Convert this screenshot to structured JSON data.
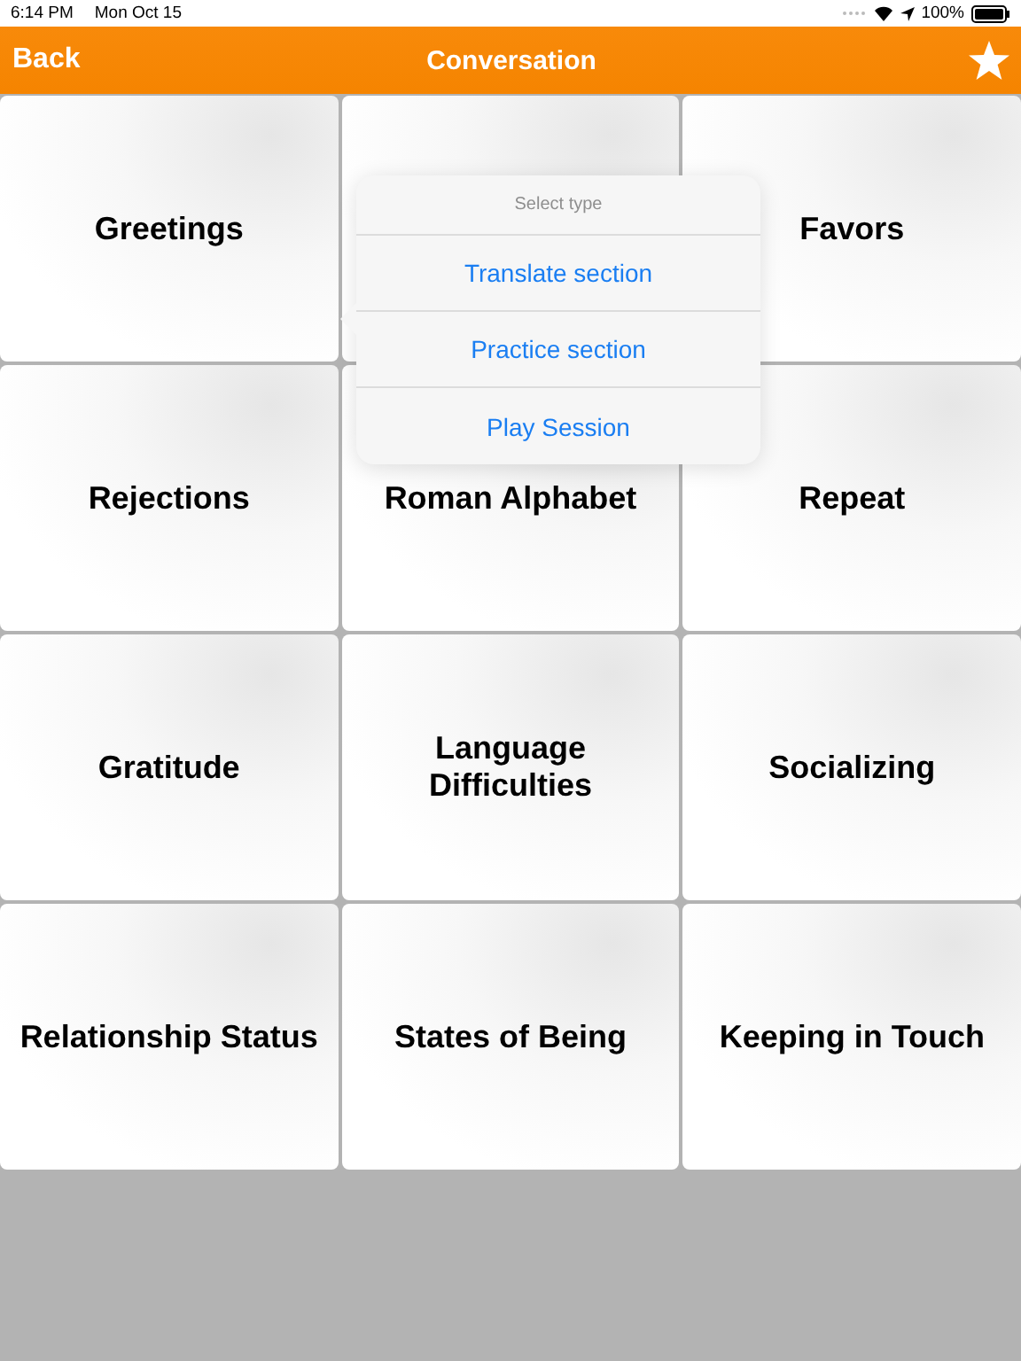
{
  "status_bar": {
    "time": "6:14 PM",
    "date": "Mon Oct 15",
    "battery": "100%"
  },
  "nav_bar": {
    "back": "Back",
    "title": "Conversation"
  },
  "categories": [
    {
      "kind": "labeled",
      "label": "Greetings"
    },
    {
      "kind": "covered"
    },
    {
      "kind": "labeled",
      "label": "Favors"
    },
    {
      "kind": "labeled",
      "label": "Rejections"
    },
    {
      "kind": "labeled",
      "label": "Roman Alphabet"
    },
    {
      "kind": "labeled",
      "label": "Repeat"
    },
    {
      "kind": "labeled",
      "label": "Gratitude"
    },
    {
      "kind": "labeled",
      "label": "Language Difficulties"
    },
    {
      "kind": "labeled",
      "label": "Socializing"
    },
    {
      "kind": "labeled",
      "label": "Relationship Status"
    },
    {
      "kind": "labeled",
      "label": "States of Being"
    },
    {
      "kind": "labeled",
      "label": "Keeping in Touch"
    }
  ],
  "popover": {
    "title": "Select type",
    "options": [
      "Translate section",
      "Practice section",
      "Play Session"
    ]
  }
}
